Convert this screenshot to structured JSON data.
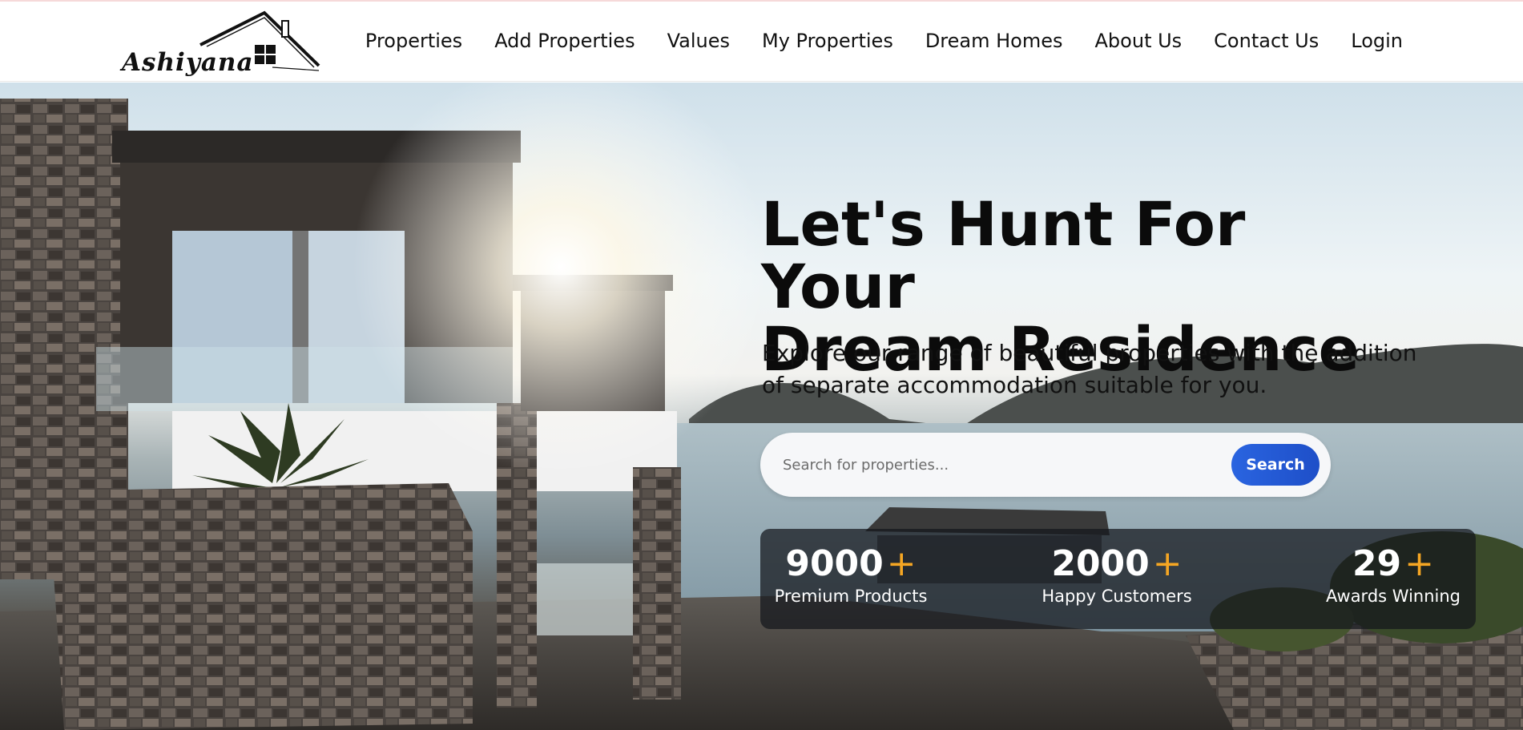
{
  "header": {
    "logo_text": "Ashiyana",
    "nav": [
      {
        "label": "Properties"
      },
      {
        "label": "Add Properties"
      },
      {
        "label": "Values"
      },
      {
        "label": "My Properties"
      },
      {
        "label": "Dream Homes"
      },
      {
        "label": "About Us"
      },
      {
        "label": "Contact Us"
      },
      {
        "label": "Login"
      }
    ]
  },
  "hero": {
    "title_line1": "Let's Hunt For Your",
    "title_line2": "Dream Residence",
    "subtitle": "Explore our range of beautiful properties with the addition of separate accommodation suitable for you.",
    "search": {
      "placeholder": "Search for properties...",
      "value": "",
      "button_label": "Search"
    },
    "stats": [
      {
        "number": "9000",
        "plus": "+",
        "label": "Premium Products"
      },
      {
        "number": "2000",
        "plus": "+",
        "label": "Happy Customers"
      },
      {
        "number": "29",
        "plus": "+",
        "label": "Awards Winning"
      }
    ]
  },
  "colors": {
    "accent_plus": "#f5a623",
    "search_button": "#2a64e0",
    "stats_panel": "#14161c"
  }
}
